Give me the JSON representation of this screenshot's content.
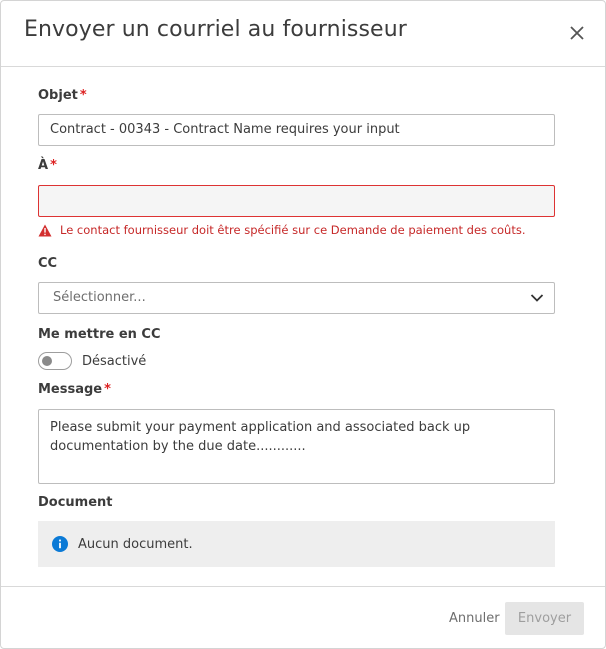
{
  "dialog": {
    "title": "Envoyer un courriel au fournisseur"
  },
  "form": {
    "subject_label": "Objet",
    "subject_value": "Contract - 00343 - Contract Name requires your input",
    "to_label": "À",
    "to_value": "",
    "to_error": "Le contact fournisseur doit être spécifié sur ce Demande de paiement des coûts.",
    "cc_label": "CC",
    "cc_placeholder": "Sélectionner...",
    "cc_me_label": "Me mettre en CC",
    "cc_me_toggle_state": "Désactivé",
    "message_label": "Message",
    "message_value": "Please submit your payment application and associated back up documentation by the due date............",
    "document_label": "Document",
    "document_empty": "Aucun document.",
    "required_marker": "*"
  },
  "footer": {
    "cancel_label": "Annuler",
    "send_label": "Envoyer"
  },
  "colors": {
    "error": "#c62828",
    "required": "#dd2222",
    "info": "#0b7ad6",
    "disabled_button_bg": "#e5e5e5"
  },
  "icons": [
    "close-icon",
    "warning-icon",
    "chevron-down-icon",
    "info-icon"
  ]
}
